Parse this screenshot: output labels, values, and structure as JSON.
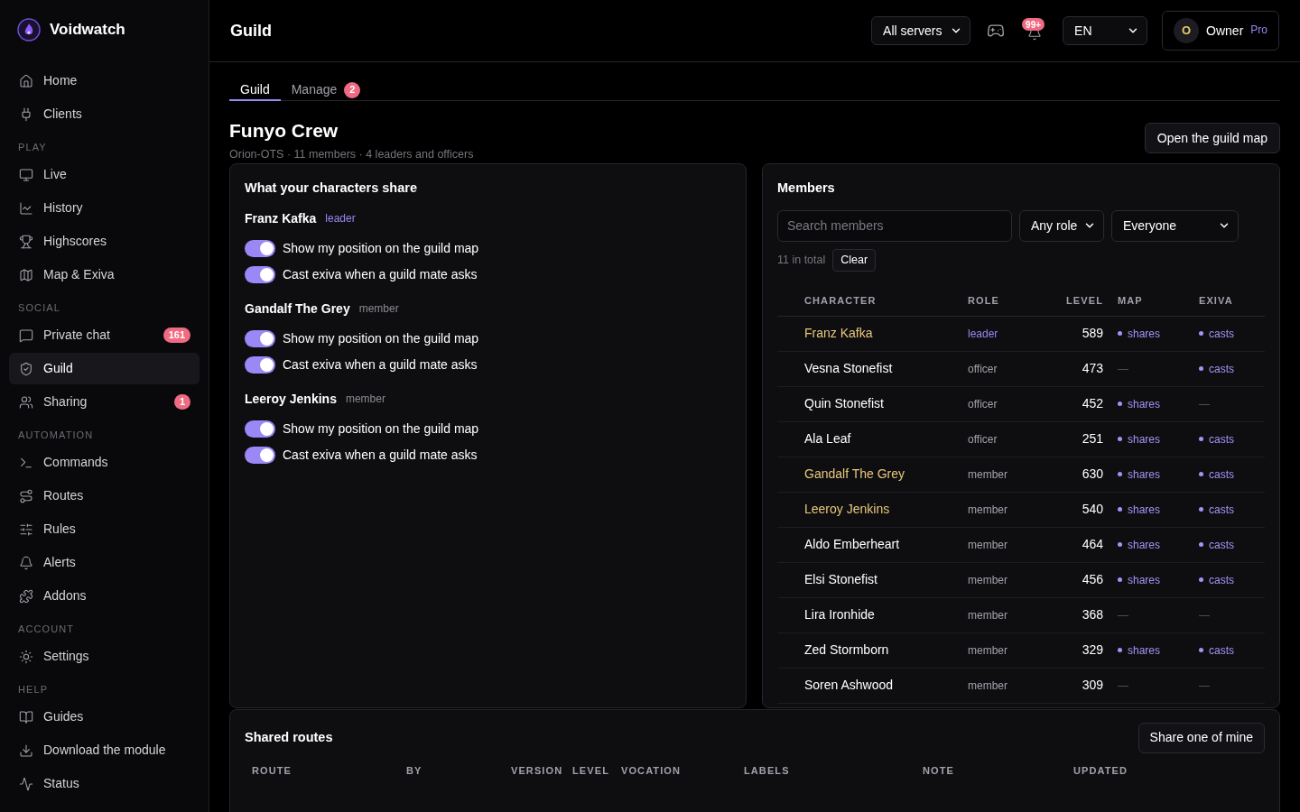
{
  "sidebar": {
    "brand": "Voidwatch",
    "groups": [
      {
        "items": [
          {
            "label": "Home",
            "selected": false
          },
          {
            "label": "Clients",
            "selected": false
          }
        ]
      },
      {
        "heading": "PLAY",
        "items": [
          {
            "label": "Live",
            "selected": false
          },
          {
            "label": "History",
            "selected": false
          },
          {
            "label": "Highscores",
            "selected": false
          },
          {
            "label": "Map & Exiva",
            "selected": false
          }
        ]
      },
      {
        "heading": "SOCIAL",
        "items": [
          {
            "label": "Private chat",
            "selected": false,
            "badge": "161"
          },
          {
            "label": "Guild",
            "selected": true
          },
          {
            "label": "Sharing",
            "selected": false,
            "badge": "1"
          }
        ]
      },
      {
        "heading": "AUTOMATION",
        "items": [
          {
            "label": "Commands",
            "selected": false
          },
          {
            "label": "Routes",
            "selected": false
          },
          {
            "label": "Rules",
            "selected": false
          },
          {
            "label": "Alerts",
            "selected": false
          },
          {
            "label": "Addons",
            "selected": false
          }
        ]
      },
      {
        "heading": "ACCOUNT",
        "items": [
          {
            "label": "Settings",
            "selected": false
          }
        ]
      },
      {
        "heading": "HELP",
        "items": [
          {
            "label": "Guides",
            "selected": false
          },
          {
            "label": "Download the module",
            "selected": false
          },
          {
            "label": "Status",
            "selected": false
          }
        ]
      }
    ]
  },
  "header": {
    "title": "Guild",
    "server_select": "All servers",
    "notifications_badge": "99+",
    "language_select": "EN",
    "user": {
      "initial": "O",
      "name": "Owner",
      "plan": "Pro"
    }
  },
  "tabs": [
    {
      "label": "Guild",
      "selected": true
    },
    {
      "label": "Manage",
      "selected": false,
      "badge": "2"
    }
  ],
  "guild": {
    "name": "Funyo Crew",
    "subtitle": "Orion-OTS · 11 members · 4 leaders and officers",
    "map_button": "Open the guild map"
  },
  "sharing": {
    "title": "What your characters share",
    "characters": [
      {
        "name": "Franz Kafka",
        "role": "leader",
        "role_highlight": true,
        "toggles": [
          {
            "label": "Show my position on the guild map",
            "on": true
          },
          {
            "label": "Cast exiva when a guild mate asks",
            "on": true
          }
        ]
      },
      {
        "name": "Gandalf The Grey",
        "role": "member",
        "role_highlight": false,
        "toggles": [
          {
            "label": "Show my position on the guild map",
            "on": true
          },
          {
            "label": "Cast exiva when a guild mate asks",
            "on": true
          }
        ]
      },
      {
        "name": "Leeroy Jenkins",
        "role": "member",
        "role_highlight": false,
        "toggles": [
          {
            "label": "Show my position on the guild map",
            "on": true
          },
          {
            "label": "Cast exiva when a guild mate asks",
            "on": true
          }
        ]
      }
    ]
  },
  "members": {
    "title": "Members",
    "search": {
      "placeholder": "Search members"
    },
    "role_select": "Any role",
    "scope_select": "Everyone",
    "total": "11 in total",
    "clear_button": "Clear",
    "columns": [
      "CHARACTER",
      "ROLE",
      "LEVEL",
      "MAP",
      "EXIVA"
    ],
    "rows": [
      {
        "name": "Franz Kafka",
        "mine": true,
        "role": "leader",
        "role_highlight": true,
        "level": "589",
        "map": {
          "text": "shares",
          "on": true
        },
        "exiva": {
          "text": "casts",
          "on": true
        }
      },
      {
        "name": "Vesna Stonefist",
        "mine": false,
        "role": "officer",
        "role_highlight": false,
        "level": "473",
        "map": {
          "text": "—",
          "on": false
        },
        "exiva": {
          "text": "casts",
          "on": true
        }
      },
      {
        "name": "Quin Stonefist",
        "mine": false,
        "role": "officer",
        "role_highlight": false,
        "level": "452",
        "map": {
          "text": "shares",
          "on": true
        },
        "exiva": {
          "text": "—",
          "on": false
        }
      },
      {
        "name": "Ala Leaf",
        "mine": false,
        "role": "officer",
        "role_highlight": false,
        "level": "251",
        "map": {
          "text": "shares",
          "on": true
        },
        "exiva": {
          "text": "casts",
          "on": true
        }
      },
      {
        "name": "Gandalf The Grey",
        "mine": true,
        "role": "member",
        "role_highlight": false,
        "level": "630",
        "map": {
          "text": "shares",
          "on": true
        },
        "exiva": {
          "text": "casts",
          "on": true
        }
      },
      {
        "name": "Leeroy Jenkins",
        "mine": true,
        "role": "member",
        "role_highlight": false,
        "level": "540",
        "map": {
          "text": "shares",
          "on": true
        },
        "exiva": {
          "text": "casts",
          "on": true
        }
      },
      {
        "name": "Aldo Emberheart",
        "mine": false,
        "role": "member",
        "role_highlight": false,
        "level": "464",
        "map": {
          "text": "shares",
          "on": true
        },
        "exiva": {
          "text": "casts",
          "on": true
        }
      },
      {
        "name": "Elsi Stonefist",
        "mine": false,
        "role": "member",
        "role_highlight": false,
        "level": "456",
        "map": {
          "text": "shares",
          "on": true
        },
        "exiva": {
          "text": "casts",
          "on": true
        }
      },
      {
        "name": "Lira Ironhide",
        "mine": false,
        "role": "member",
        "role_highlight": false,
        "level": "368",
        "map": {
          "text": "—",
          "on": false
        },
        "exiva": {
          "text": "—",
          "on": false
        }
      },
      {
        "name": "Zed Stormborn",
        "mine": false,
        "role": "member",
        "role_highlight": false,
        "level": "329",
        "map": {
          "text": "shares",
          "on": true
        },
        "exiva": {
          "text": "casts",
          "on": true
        }
      },
      {
        "name": "Soren Ashwood",
        "mine": false,
        "role": "member",
        "role_highlight": false,
        "level": "309",
        "map": {
          "text": "—",
          "on": false
        },
        "exiva": {
          "text": "—",
          "on": false
        }
      }
    ]
  },
  "shared_routes": {
    "title": "Shared routes",
    "share_button": "Share one of mine",
    "columns": [
      "ROUTE",
      "BY",
      "VERSION",
      "LEVEL",
      "VOCATION",
      "LABELS",
      "NOTE",
      "UPDATED"
    ]
  }
}
